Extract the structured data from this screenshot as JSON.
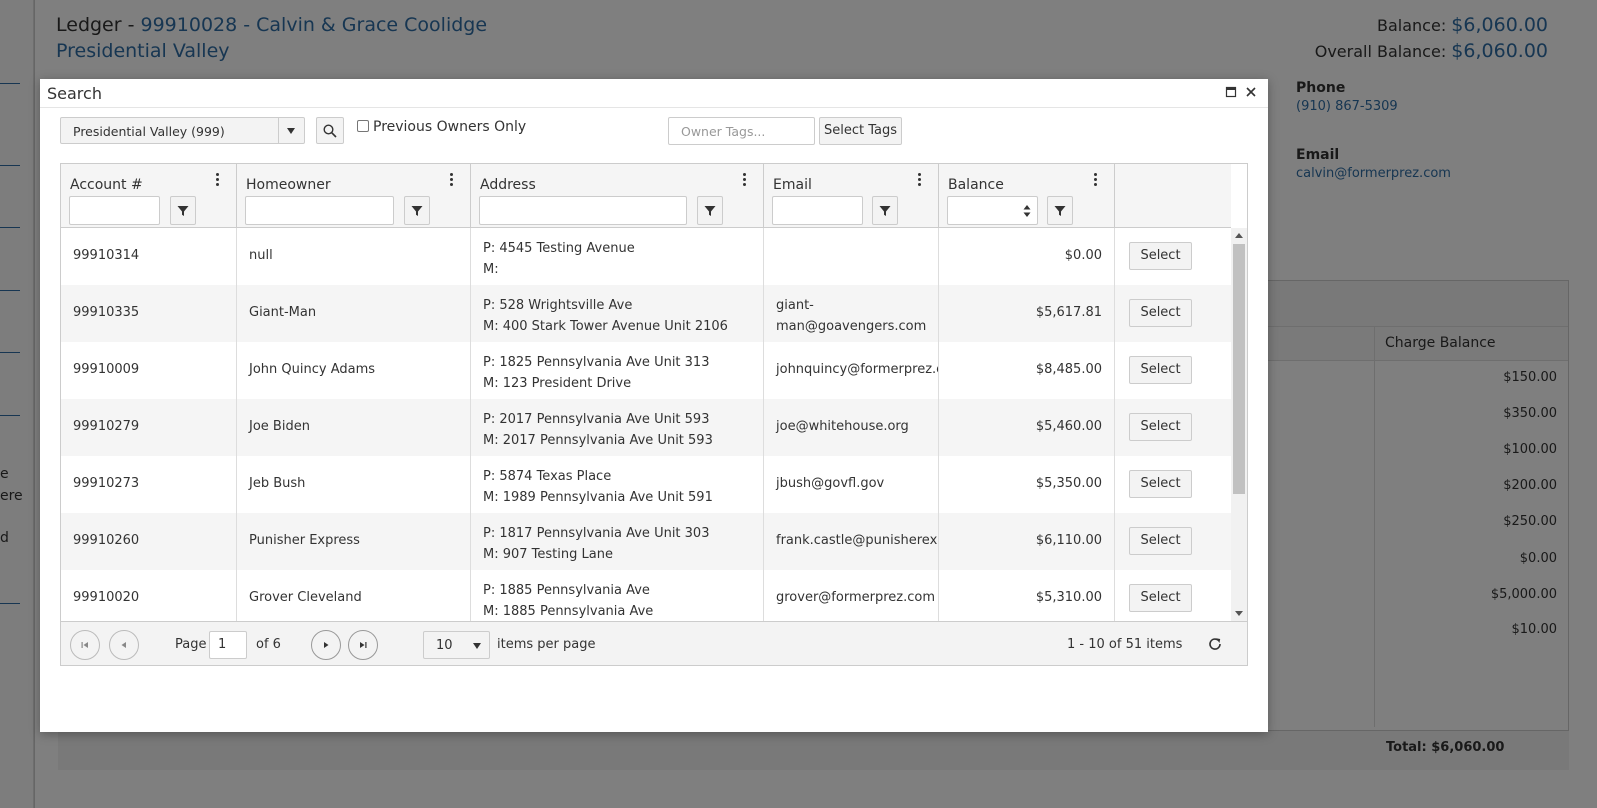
{
  "ledger": {
    "prefix": "Ledger - ",
    "account_link": "99910028 - Calvin & Grace Coolidge",
    "community": "Presidential Valley",
    "balance_label": "Balance:",
    "balance_value": "$6,060.00",
    "overall_label": "Overall Balance:",
    "overall_value": "$6,060.00",
    "phone_label": "Phone",
    "phone_value": "(910) 867-5309",
    "email_label": "Email",
    "email_value": "calvin@formerprez.com",
    "left_fragments": [
      "e",
      "ere",
      "d"
    ],
    "charge_header": "Charge Balance",
    "charges": [
      "$150.00",
      "$350.00",
      "$100.00",
      "$200.00",
      "$250.00",
      "$0.00",
      "$5,000.00",
      "$10.00"
    ],
    "total": "Total: $6,060.00"
  },
  "modal": {
    "title": "Search",
    "community_select": "Presidential Valley (999)",
    "previous_owners_label": "Previous Owners Only",
    "tags_placeholder": "Owner Tags...",
    "select_tags_label": "Select Tags"
  },
  "grid": {
    "columns": [
      "Account #",
      "Homeowner",
      "Address",
      "Email",
      "Balance"
    ],
    "select_label": "Select",
    "rows": [
      {
        "account": "99910314",
        "owner": "null",
        "p": "P: 4545 Testing Avenue",
        "m": "M:",
        "email": "",
        "balance": "$0.00"
      },
      {
        "account": "99910335",
        "owner": "Giant-Man",
        "p": "P: 528 Wrightsville Ave",
        "m": "M: 400 Stark Tower Avenue Unit 2106",
        "email": "giant-",
        "email2": "man@goavengers.com",
        "balance": "$5,617.81"
      },
      {
        "account": "99910009",
        "owner": "John Quincy Adams",
        "p": "P: 1825 Pennsylvania Ave Unit 313",
        "m": "M: 123 President Drive",
        "email": "johnquincy@formerprez.com",
        "balance": "$8,485.00"
      },
      {
        "account": "99910279",
        "owner": "Joe Biden",
        "p": "P: 2017 Pennsylvania Ave Unit 593",
        "m": "M: 2017 Pennsylvania Ave Unit 593",
        "email": "joe@whitehouse.org",
        "balance": "$5,460.00"
      },
      {
        "account": "99910273",
        "owner": "Jeb Bush",
        "p": "P: 5874 Texas Place",
        "m": "M: 1989 Pennsylvania Ave Unit 591",
        "email": "jbush@govfl.gov",
        "balance": "$5,350.00"
      },
      {
        "account": "99910260",
        "owner": "Punisher Express",
        "p": "P: 1817 Pennsylvania Ave Unit 303",
        "m": "M: 907 Testing Lane",
        "email": "frank.castle@punisherexpress.com",
        "balance": "$6,110.00"
      },
      {
        "account": "99910020",
        "owner": "Grover Cleveland",
        "p": "P: 1885 Pennsylvania Ave",
        "m": "M: 1885 Pennsylvania Ave",
        "email": "grover@formerprez.com",
        "balance": "$5,310.00"
      }
    ]
  },
  "pager": {
    "page_label": "Page",
    "page_value": "1",
    "of_label": "of 6",
    "page_size": "10",
    "per_page_label": "items per page",
    "summary": "1 - 10 of 51 items"
  }
}
